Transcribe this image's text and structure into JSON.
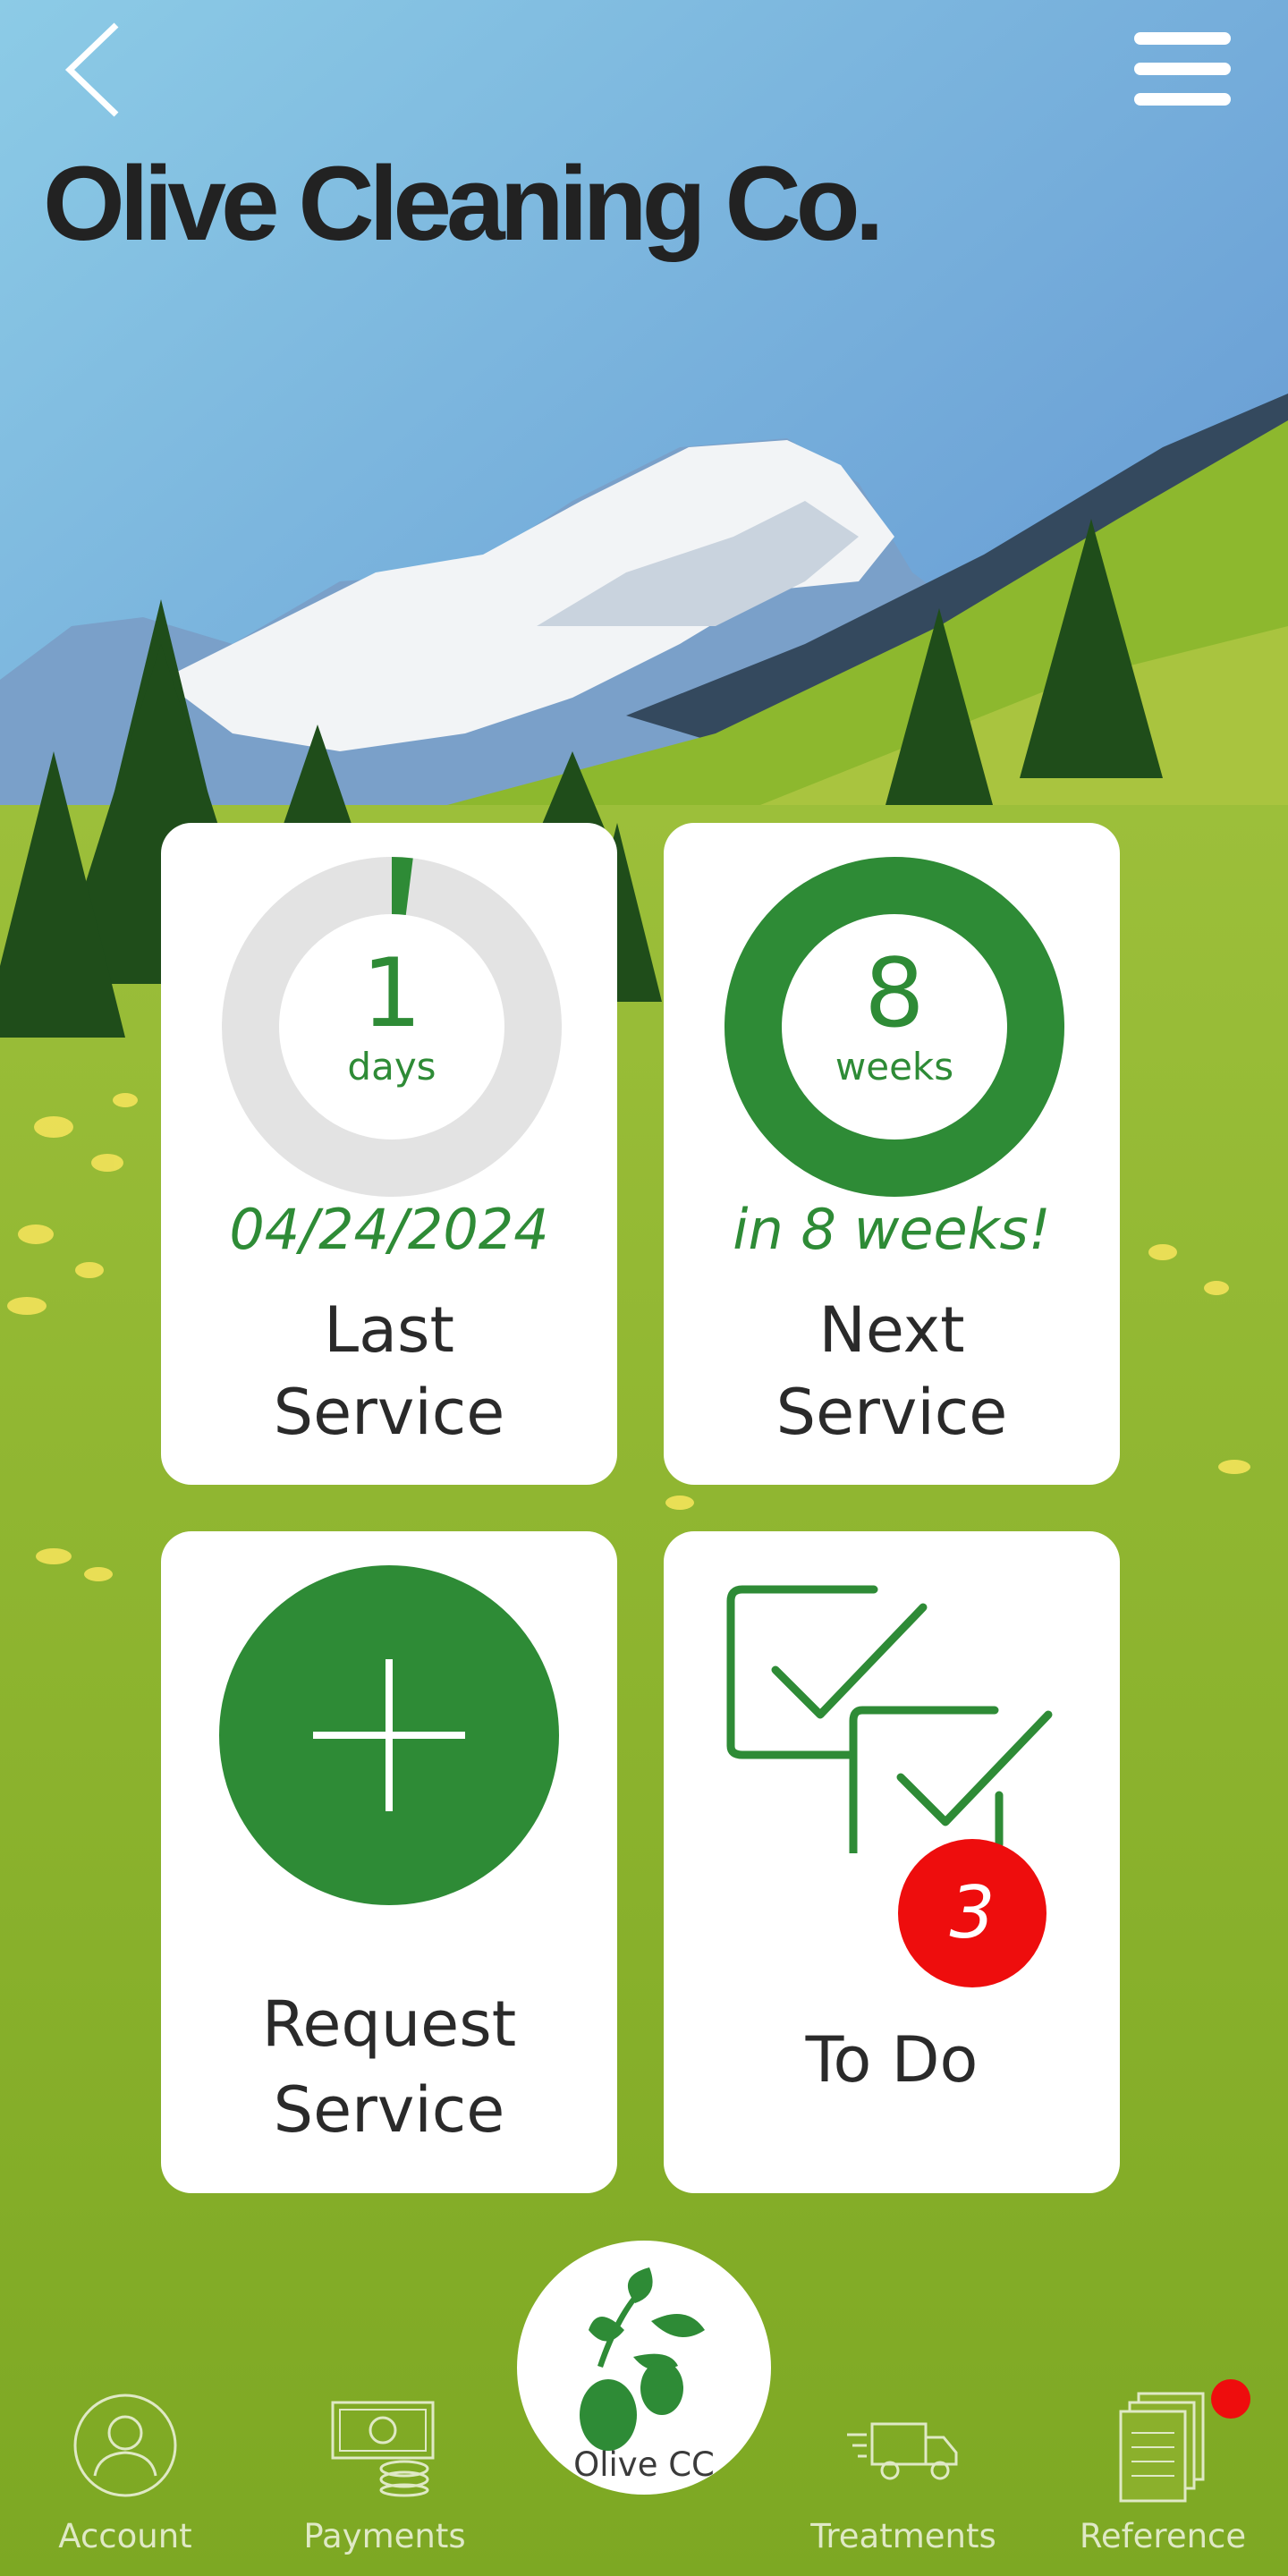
{
  "colors": {
    "brand_green": "#2e8b36",
    "badge_red": "#ee0d0d",
    "sky_top": "#8cc5e6",
    "grass": "#8bb02c"
  },
  "header": {
    "logo_text": "Olive Cleaning Co.",
    "back_icon": "chevron-left-icon",
    "menu_icon": "hamburger-menu-icon"
  },
  "cards": {
    "last_service": {
      "value": "1",
      "unit": "days",
      "date": "04/24/2024",
      "title_line1": "Last",
      "title_line2": "Service",
      "progress_fraction": 0.02
    },
    "next_service": {
      "value": "8",
      "unit": "weeks",
      "subtitle": "in 8 weeks!",
      "title_line1": "Next",
      "title_line2": "Service",
      "progress_fraction": 1.0
    },
    "request_service": {
      "title_line1": "Request",
      "title_line2": "Service",
      "icon": "plus-icon"
    },
    "todo": {
      "title": "To Do",
      "badge_count": "3",
      "icon": "checklist-icon"
    }
  },
  "nav": {
    "items": [
      {
        "label": "Account",
        "icon": "account-icon"
      },
      {
        "label": "Payments",
        "icon": "payments-icon"
      },
      {
        "label": "Olive CC",
        "icon": "olive-branch-icon"
      },
      {
        "label": "Treatments",
        "icon": "truck-icon"
      },
      {
        "label": "Reference",
        "icon": "documents-icon"
      }
    ]
  }
}
